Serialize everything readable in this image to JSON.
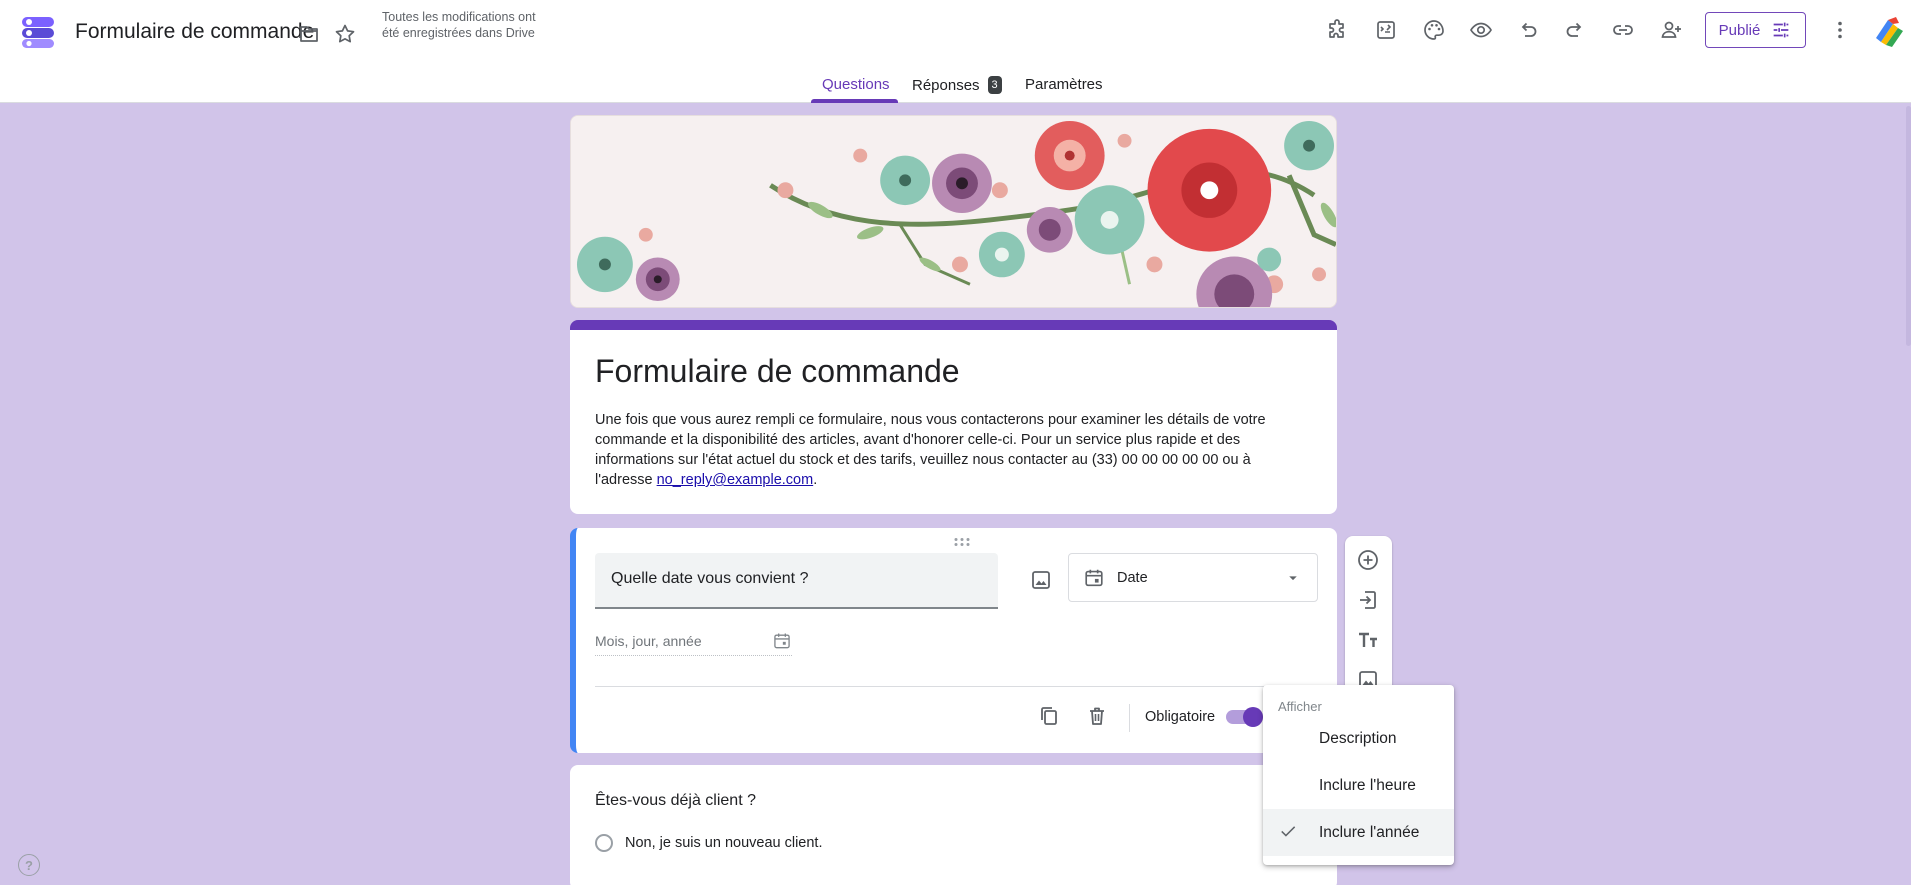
{
  "header": {
    "title": "Formulaire de commande",
    "save_status": "Toutes les modifications ont été enregistrées dans Drive",
    "publish_label": "Publié",
    "icons": [
      "folder-icon",
      "star-icon",
      "addons-icon",
      "apps-script-icon",
      "palette-icon",
      "preview-icon",
      "undo-icon",
      "redo-icon",
      "link-icon",
      "add-person-icon",
      "tune-icon",
      "more-vert-icon"
    ]
  },
  "tabs": {
    "questions": "Questions",
    "responses": "Réponses",
    "responses_count": "3",
    "settings": "Paramètres"
  },
  "form": {
    "title": "Formulaire de commande",
    "description": "Une fois que vous aurez rempli ce formulaire, nous vous contacterons pour examiner les détails de votre commande et la disponibilité des articles, avant d'honorer celle-ci. Pour un service plus rapide et des informations sur l'état actuel du stock et des tarifs, veuillez nous contacter au (33) 00 00 00 00 00 ou à l'adresse ",
    "email": "no_reply@example.com",
    "description_end": "."
  },
  "question_active": {
    "title": "Quelle date vous convient ?",
    "type": "Date",
    "date_placeholder": "Mois, jour, année",
    "required_label": "Obligatoire",
    "required": true
  },
  "question_2": {
    "title": "Êtes-vous déjà client ?",
    "options": [
      "Non, je suis un nouveau client."
    ]
  },
  "menu": {
    "header": "Afficher",
    "items": [
      {
        "label": "Description",
        "checked": false
      },
      {
        "label": "Inclure l'heure",
        "checked": false
      },
      {
        "label": "Inclure l'année",
        "checked": true
      }
    ]
  },
  "side_toolbar": [
    "add-question-icon",
    "import-questions-icon",
    "add-title-icon",
    "add-image-icon"
  ],
  "colors": {
    "accent": "#673ab7",
    "background": "#d1c4e9",
    "active_question_border": "#4285f4"
  },
  "help_glyph": "?"
}
